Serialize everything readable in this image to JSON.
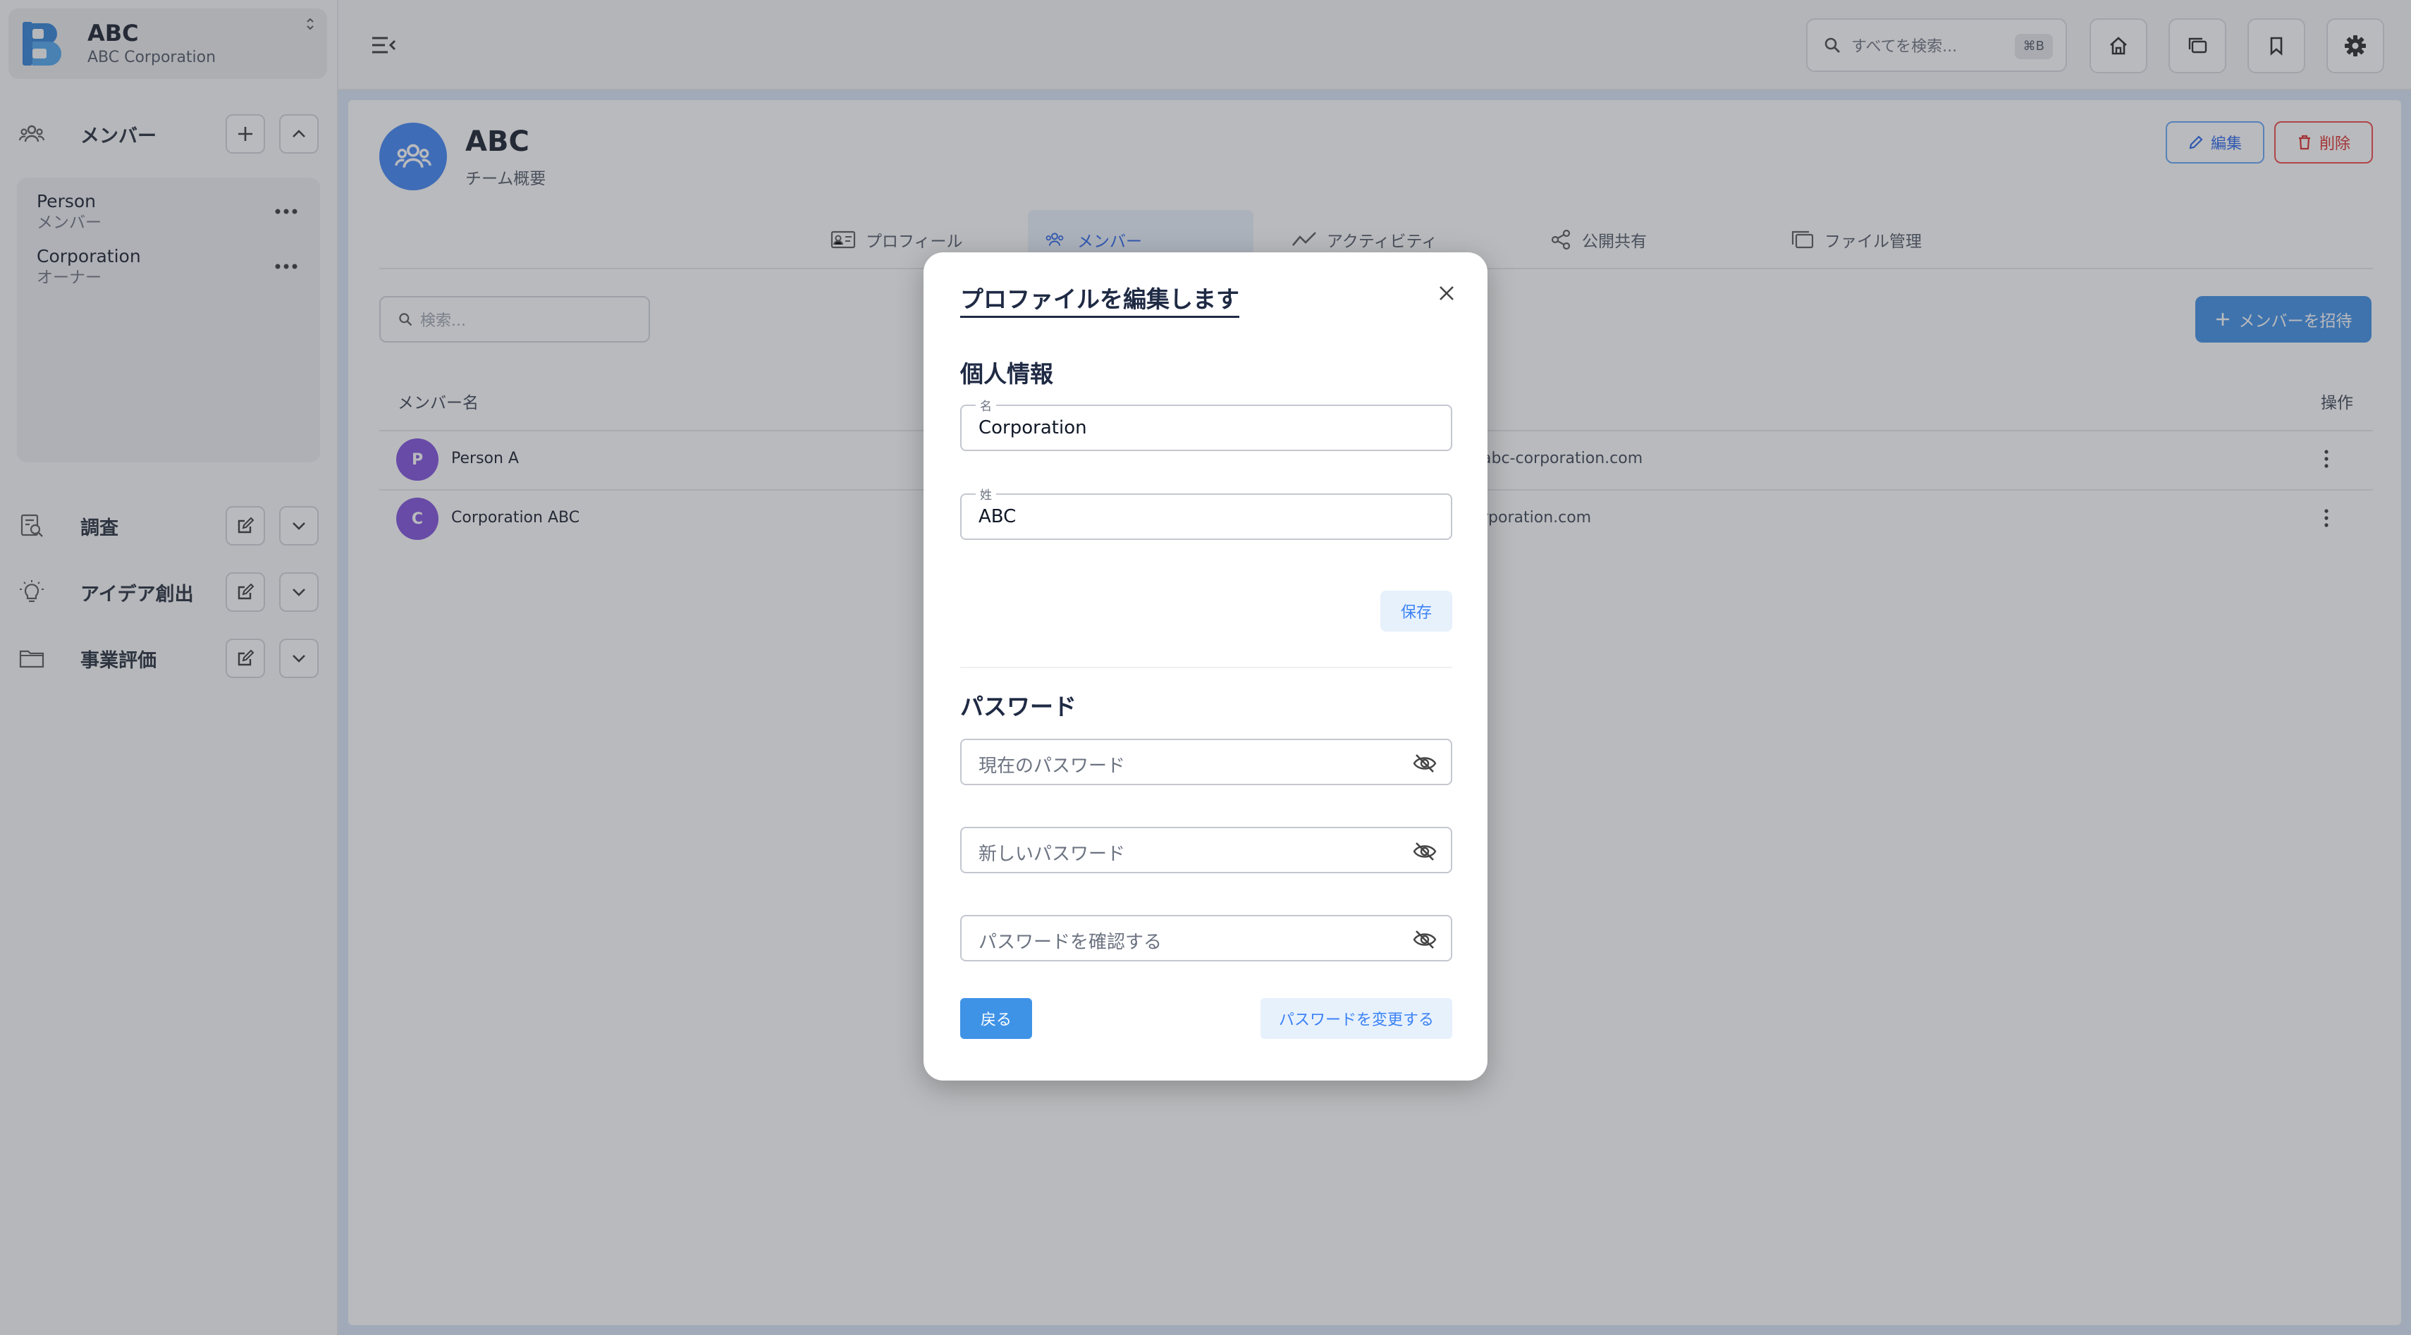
{
  "brand": {
    "title": "ABC",
    "subtitle": "ABC Corporation"
  },
  "sidebar": {
    "members_section": {
      "label": "メンバー"
    },
    "members": [
      {
        "name": "Person",
        "role": "メンバー"
      },
      {
        "name": "Corporation",
        "role": "オーナー"
      }
    ],
    "sections": [
      {
        "label": "調査",
        "icon": "research-icon"
      },
      {
        "label": "アイデア創出",
        "icon": "lightbulb-icon"
      },
      {
        "label": "事業評価",
        "icon": "folder-icon"
      }
    ]
  },
  "topbar": {
    "search_placeholder": "すべてを検索...",
    "search_shortcut": "⌘B"
  },
  "team": {
    "title": "ABC",
    "subtitle": "チーム概要",
    "edit_label": "編集",
    "delete_label": "削除"
  },
  "tabs": [
    {
      "label": "プロフィール"
    },
    {
      "label": "メンバー"
    },
    {
      "label": "アクティビティ"
    },
    {
      "label": "公開共有"
    },
    {
      "label": "ファイル管理"
    }
  ],
  "members_list": {
    "search_placeholder": "検索...",
    "invite_label": "メンバーを招待",
    "columns": {
      "name": "メンバー名",
      "actions": "操作"
    },
    "rows": [
      {
        "initial": "P",
        "name": "Person A",
        "email_fragment": "abc-corporation.com"
      },
      {
        "initial": "C",
        "name": "Corporation ABC",
        "email_fragment": "rporation.com"
      }
    ]
  },
  "modal": {
    "title": "プロファイルを編集します",
    "personal_heading": "個人情報",
    "first_name_label": "名",
    "first_name_value": "Corporation",
    "last_name_label": "姓",
    "last_name_value": "ABC",
    "save_label": "保存",
    "password_heading": "パスワード",
    "current_password_placeholder": "現在のパスワード",
    "new_password_placeholder": "新しいパスワード",
    "confirm_password_placeholder": "パスワードを確認する",
    "back_label": "戻る",
    "change_password_label": "パスワードを変更する"
  },
  "colors": {
    "accent": "#3b8de6",
    "danger": "#dc2626",
    "avatar": "#7c4ddb"
  }
}
